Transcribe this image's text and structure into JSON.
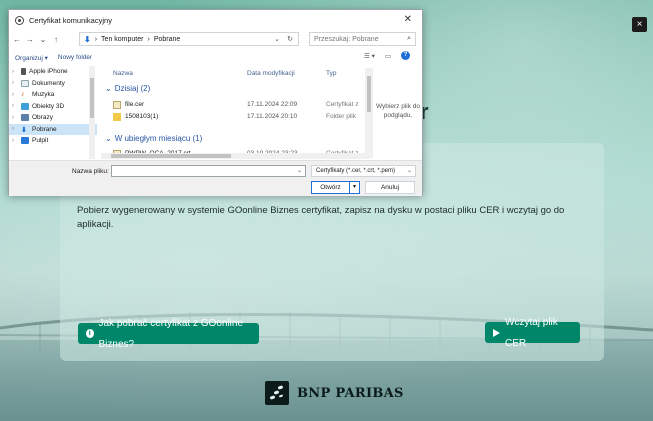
{
  "page": {
    "close_symbol": "×",
    "heading_fragment": "r",
    "description": "Pobierz wygenerowany w systemie GOonline Biznes certyfikat, zapisz na dysku w postaci pliku CER i wczytaj go do aplikacji.",
    "howto_button": "Jak pobrać certyfikat z GOonline Biznes?",
    "load_button": "Wczytaj plik CER",
    "logo_text": "BNP PARIBAS",
    "accent_color": "#00876a"
  },
  "dialog": {
    "title": "Certyfikat komunikacyjny",
    "close_symbol": "✕",
    "breadcrumb": [
      "Ten komputer",
      "Pobrane"
    ],
    "search_placeholder": "Przeszukaj: Pobrane",
    "toolbar": {
      "organize": "Organizuj ▾",
      "new_folder": "Nowy folder"
    },
    "tree": [
      {
        "label": "Apple iPhone",
        "icon": "phone-icon"
      },
      {
        "label": "Dokumenty",
        "icon": "documents-icon"
      },
      {
        "label": "Muzyka",
        "icon": "music-icon"
      },
      {
        "label": "Obiekty 3D",
        "icon": "cube-icon"
      },
      {
        "label": "Obrazy",
        "icon": "pictures-icon"
      },
      {
        "label": "Pobrane",
        "icon": "download-icon",
        "selected": true
      },
      {
        "label": "Pulpit",
        "icon": "desktop-icon"
      }
    ],
    "columns": {
      "name": "Nazwa",
      "date": "Data modyfikacji",
      "type": "Typ"
    },
    "groups": [
      {
        "label": "Dzisiaj (2)",
        "files": [
          {
            "name": "file.cer",
            "date": "17.11.2024 22:09",
            "type": "Certyfikat z"
          },
          {
            "name": "1508103(1)",
            "date": "17.11.2024 20:10",
            "type": "Folder plik"
          }
        ]
      },
      {
        "label": "W ubiegłym miesiącu (1)",
        "files": [
          {
            "name": "PWPW_OCA_2017.crt",
            "date": "03.10.2024 23:23",
            "type": "Certyfikat z"
          }
        ]
      }
    ],
    "preview_text": "Wybierz plik do podglądu.",
    "filename_label": "Nazwa pliku:",
    "filename_value": "",
    "filter": "Certyfikaty (*.cer, *.crt, *.pem)",
    "open_button": "Otwórz",
    "cancel_button": "Anuluj"
  }
}
